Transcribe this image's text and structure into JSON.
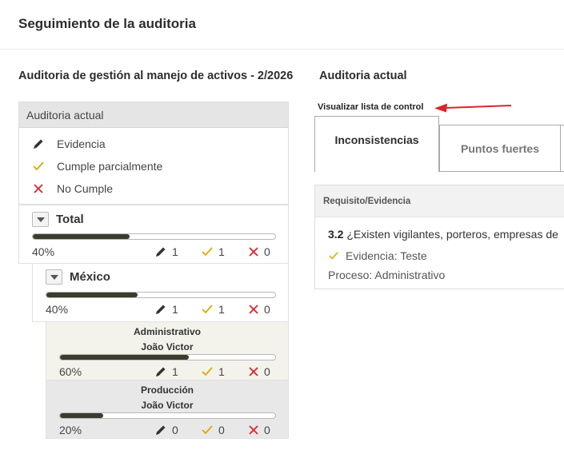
{
  "page": {
    "title": "Seguimiento de la auditoria"
  },
  "audit": {
    "title": "Auditoria de gestión al manejo de activos - 2/2026"
  },
  "current": {
    "title": "Auditoria actual"
  },
  "legend": {
    "header": "Auditoria actual",
    "items": [
      {
        "icon": "pencil-icon",
        "label": "Evidencia"
      },
      {
        "icon": "check-icon",
        "label": "Cumple parcialmente"
      },
      {
        "icon": "x-icon",
        "label": "No Cumple"
      }
    ]
  },
  "tree": {
    "total": {
      "label": "Total",
      "progress": 0.4,
      "pct": "40%",
      "evidence": "1",
      "partial": "1",
      "fail": "0"
    },
    "mexico": {
      "label": "México",
      "progress": 0.4,
      "pct": "40%",
      "evidence": "1",
      "partial": "1",
      "fail": "0"
    },
    "administrativo": {
      "label": "Administrativo",
      "owner": "João Victor",
      "progress": 0.6,
      "pct": "60%",
      "evidence": "1",
      "partial": "1",
      "fail": "0"
    },
    "produccion": {
      "label": "Producción",
      "owner": "João Victor",
      "progress": 0.2,
      "pct": "20%",
      "evidence": "0",
      "partial": "0",
      "fail": "0"
    }
  },
  "checklist": {
    "link_label": "Visualizar lista de control"
  },
  "tabs": [
    {
      "label": "Inconsistencias",
      "active": true
    },
    {
      "label": "Puntos fuertes",
      "active": false
    }
  ],
  "requirements": {
    "header": "Requisito/Evidencia",
    "item": {
      "number": "3.2",
      "text": "¿Existen vigilantes, porteros, empresas de",
      "evidence": "Evidencia: Teste",
      "process": "Proceso: Administrativo"
    }
  },
  "colors": {
    "check": "#e0a800",
    "fail": "#d9262b",
    "arrow": "#d9262b",
    "progress": "#3b3b2e"
  }
}
